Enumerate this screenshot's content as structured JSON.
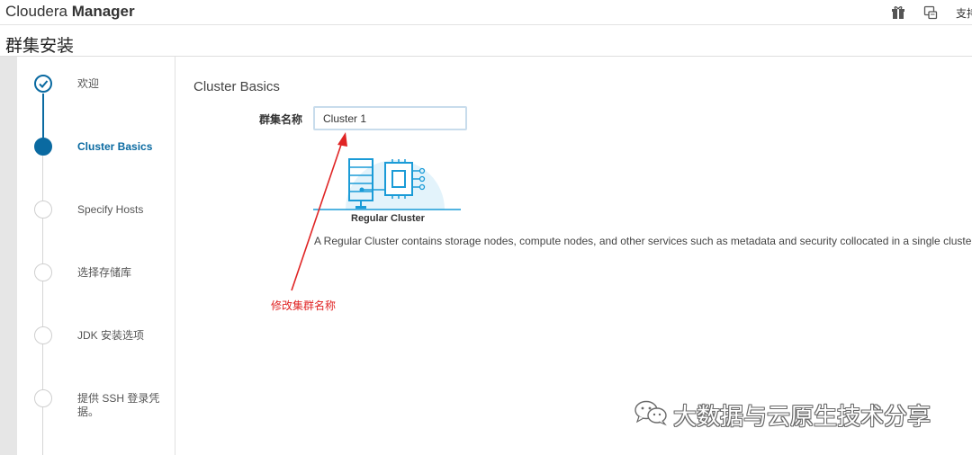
{
  "header": {
    "brand_light": "Cloudera ",
    "brand_bold": "Manager",
    "support_label": "支持",
    "icons": [
      "gift-icon",
      "assistant-icon"
    ]
  },
  "page": {
    "title": "群集安装"
  },
  "steps": [
    {
      "label": "欢迎",
      "state": "done"
    },
    {
      "label": "Cluster Basics",
      "state": "active"
    },
    {
      "label": "Specify Hosts",
      "state": "pending"
    },
    {
      "label": "选择存储库",
      "state": "pending"
    },
    {
      "label": "JDK 安装选项",
      "state": "pending"
    },
    {
      "label": "提供 SSH 登录凭据。",
      "state": "pending"
    }
  ],
  "main": {
    "section_title": "Cluster Basics",
    "name_label": "群集名称",
    "name_value": "Cluster 1",
    "cluster_type_label": "Regular Cluster",
    "cluster_type_desc": "A Regular Cluster contains storage nodes, compute nodes, and other services such as metadata and security collocated in a single cluster."
  },
  "annotation": {
    "text": "修改集群名称",
    "color": "#e02424"
  },
  "watermark": {
    "text": "大数据与云原生技术分享"
  },
  "colors": {
    "accent": "#0a6aa1",
    "illustration": "#1a9bd7",
    "illustration_bg": "#e3f3fb"
  }
}
